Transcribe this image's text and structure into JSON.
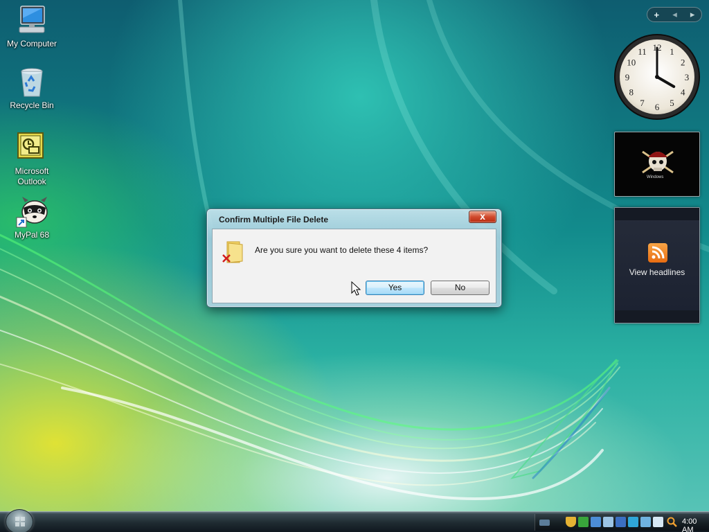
{
  "desktop": {
    "icons": [
      {
        "label": "My Computer",
        "icon": "computer-icon"
      },
      {
        "label": "Recycle Bin",
        "icon": "recycle-bin-icon"
      },
      {
        "label": "Microsoft Outlook",
        "icon": "outlook-icon"
      },
      {
        "label": "MyPal 68",
        "icon": "mypal-raccoon-icon"
      }
    ]
  },
  "sidebar": {
    "controls": {
      "add": "+",
      "prev": "◂",
      "next": "▸"
    },
    "clock": {
      "numbers": [
        "12",
        "1",
        "2",
        "3",
        "4",
        "5",
        "6",
        "7",
        "8",
        "9",
        "10",
        "11"
      ],
      "hour": 4,
      "minute": 0
    },
    "slideshow": {
      "watermark": "Windows"
    },
    "feeds": {
      "label": "View headlines"
    }
  },
  "dialog": {
    "title": "Confirm Multiple File Delete",
    "close": "x",
    "message": "Are you sure you want to delete these 4 items?",
    "yes": "Yes",
    "no": "No"
  },
  "taskbar": {
    "clock": "4:00 AM",
    "tray_icons": [
      "keyboard-icon",
      "security-shield-icon",
      "antivirus-icon",
      "network-icon",
      "volume-icon",
      "media-icon",
      "notes-icon",
      "messenger-icon",
      "display-icon",
      "search-icon"
    ]
  },
  "colors": {
    "wallpaper_teal": "#128b8c",
    "wallpaper_yellow": "#e8e43a",
    "dialog_frame": "#a6cede",
    "close_button": "#d04a2d",
    "default_button": "#bee6fd",
    "taskbar": "#1f2b31"
  }
}
